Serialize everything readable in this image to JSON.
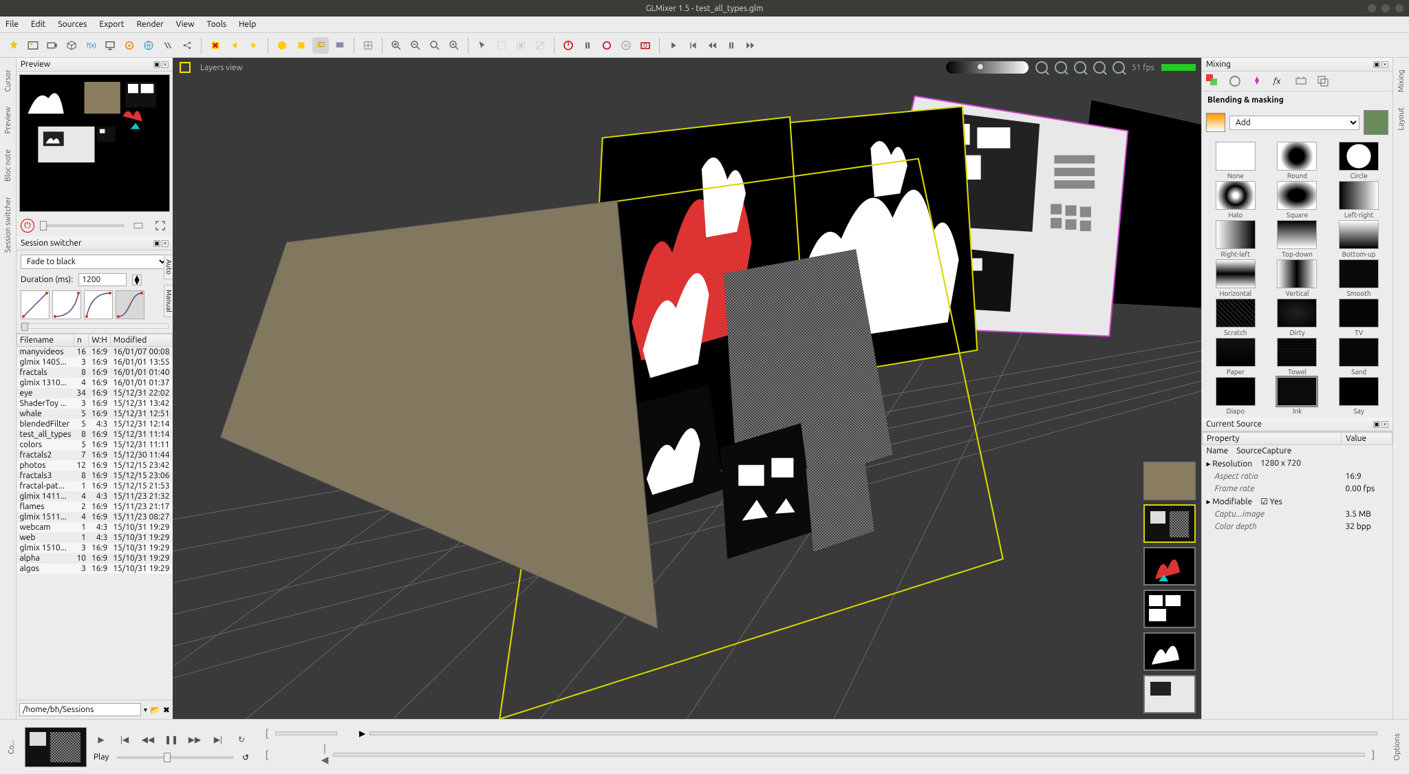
{
  "title": "GLMixer 1.5 - test_all_types.glm",
  "menu": [
    "File",
    "Edit",
    "Sources",
    "Export",
    "Render",
    "View",
    "Tools",
    "Help"
  ],
  "side_left": [
    "Cursor",
    "Preview",
    "Bloc note",
    "Session switcher"
  ],
  "side_right": [
    "Mixing",
    "Layout"
  ],
  "bottom_tab": "Co...",
  "right_bottom_tab": "Options",
  "preview": {
    "title": "Preview"
  },
  "session": {
    "title": "Session switcher",
    "transition": "Fade to black",
    "duration_label": "Duration (ms):",
    "duration": "1200",
    "vtabs": [
      "Auto",
      "Manual"
    ]
  },
  "files": {
    "headers": [
      "Filename",
      "n",
      "W:H",
      "Modified"
    ],
    "rows": [
      [
        "manyvideos",
        "16",
        "16:9",
        "16/01/07 00:08"
      ],
      [
        "glmix 1405...",
        "3",
        "16:9",
        "16/01/01 13:55"
      ],
      [
        "fractals",
        "8",
        "16:9",
        "16/01/01 01:40"
      ],
      [
        "glmix 1310...",
        "4",
        "16:9",
        "16/01/01 01:37"
      ],
      [
        "eye",
        "34",
        "16:9",
        "15/12/31 22:02"
      ],
      [
        "ShaderToy ...",
        "3",
        "16:9",
        "15/12/31 13:42"
      ],
      [
        "whale",
        "5",
        "16:9",
        "15/12/31 12:51"
      ],
      [
        "blendedFilter",
        "5",
        "4:3",
        "15/12/31 12:14"
      ],
      [
        "test_all_types",
        "8",
        "16:9",
        "15/12/31 11:14"
      ],
      [
        "colors",
        "5",
        "16:9",
        "15/12/31 11:11"
      ],
      [
        "fractals2",
        "7",
        "16:9",
        "15/12/30 11:44"
      ],
      [
        "photos",
        "12",
        "16:9",
        "15/12/15 23:42"
      ],
      [
        "fractals3",
        "8",
        "16:9",
        "15/12/15 23:06"
      ],
      [
        "fractal-pat...",
        "1",
        "16:9",
        "15/12/15 21:53"
      ],
      [
        "glmix 1411...",
        "4",
        "4:3",
        "15/11/23 21:32"
      ],
      [
        "flames",
        "2",
        "16:9",
        "15/11/23 21:17"
      ],
      [
        "glmix 1511...",
        "4",
        "16:9",
        "15/11/23 08:27"
      ],
      [
        "webcam",
        "1",
        "4:3",
        "15/10/31 19:29"
      ],
      [
        "web",
        "1",
        "4:3",
        "15/10/31 19:29"
      ],
      [
        "glmix 1510...",
        "3",
        "16:9",
        "15/10/31 19:29"
      ],
      [
        "alpha",
        "10",
        "16:9",
        "15/10/31 19:29"
      ],
      [
        "algos",
        "3",
        "16:9",
        "15/10/31 19:29"
      ]
    ],
    "path": "/home/bh/Sessions"
  },
  "viewport": {
    "label": "Layers view",
    "fps": "51 fps"
  },
  "mixing": {
    "title": "Mixing",
    "section": "Blending & masking",
    "mode": "Add",
    "masks": [
      "None",
      "Round",
      "Circle",
      "Halo",
      "Square",
      "Left-right",
      "Right-left",
      "Top-down",
      "Bottom-up",
      "Horizontal",
      "Vertical",
      "Smooth",
      "Scratch",
      "Dirty",
      "TV",
      "Paper",
      "Towel",
      "Sand",
      "Diapo",
      "Ink",
      "Say"
    ]
  },
  "source": {
    "title": "Current Source",
    "headers": [
      "Property",
      "Value"
    ],
    "rows": [
      {
        "k": "Name",
        "v": "SourceCapture",
        "main": true
      },
      {
        "k": "Resolution",
        "v": "1280 x 720",
        "main": true,
        "expand": true
      },
      {
        "k": "Aspect ratio",
        "v": "16:9"
      },
      {
        "k": "Frame rate",
        "v": "0.00 fps"
      },
      {
        "k": "Modifiable",
        "v": "☑ Yes",
        "main": true,
        "expand": true
      },
      {
        "k": "Captu...image",
        "v": "3.5 MB"
      },
      {
        "k": "Color depth",
        "v": "32 bpp"
      }
    ]
  },
  "playback": {
    "label": "Play"
  },
  "mask_styles": {
    "None": "#fff",
    "Round": "radial-gradient(circle,#000 30%,#fff 70%)",
    "Circle": "radial-gradient(circle,#fff 50%,#000 52%)",
    "Halo": "radial-gradient(circle,#fff 10%,#000 40%,#fff 80%)",
    "Square": "radial-gradient(#000 30%,#fff 80%)",
    "Left-right": "linear-gradient(to right,#000,#fff)",
    "Right-left": "linear-gradient(to left,#000,#fff)",
    "Top-down": "linear-gradient(#000,#fff)",
    "Bottom-up": "linear-gradient(#fff,#000)",
    "Horizontal": "linear-gradient(#fff,#000 50%,#fff)",
    "Vertical": "linear-gradient(to right,#fff,#000 50%,#fff)",
    "Smooth": "#0a0a0a",
    "Scratch": "repeating-linear-gradient(45deg,#000,#000 3px,#222 3px,#222 5px)",
    "Dirty": "radial-gradient(#222,#000)",
    "TV": "#050505",
    "Paper": "linear-gradient(#111,#000)",
    "Towel": "repeating-linear-gradient(#000,#111 4px)",
    "Sand": "#080808",
    "Diapo": "#000",
    "Ink": "#0c0c0c",
    "Say": "#000"
  }
}
